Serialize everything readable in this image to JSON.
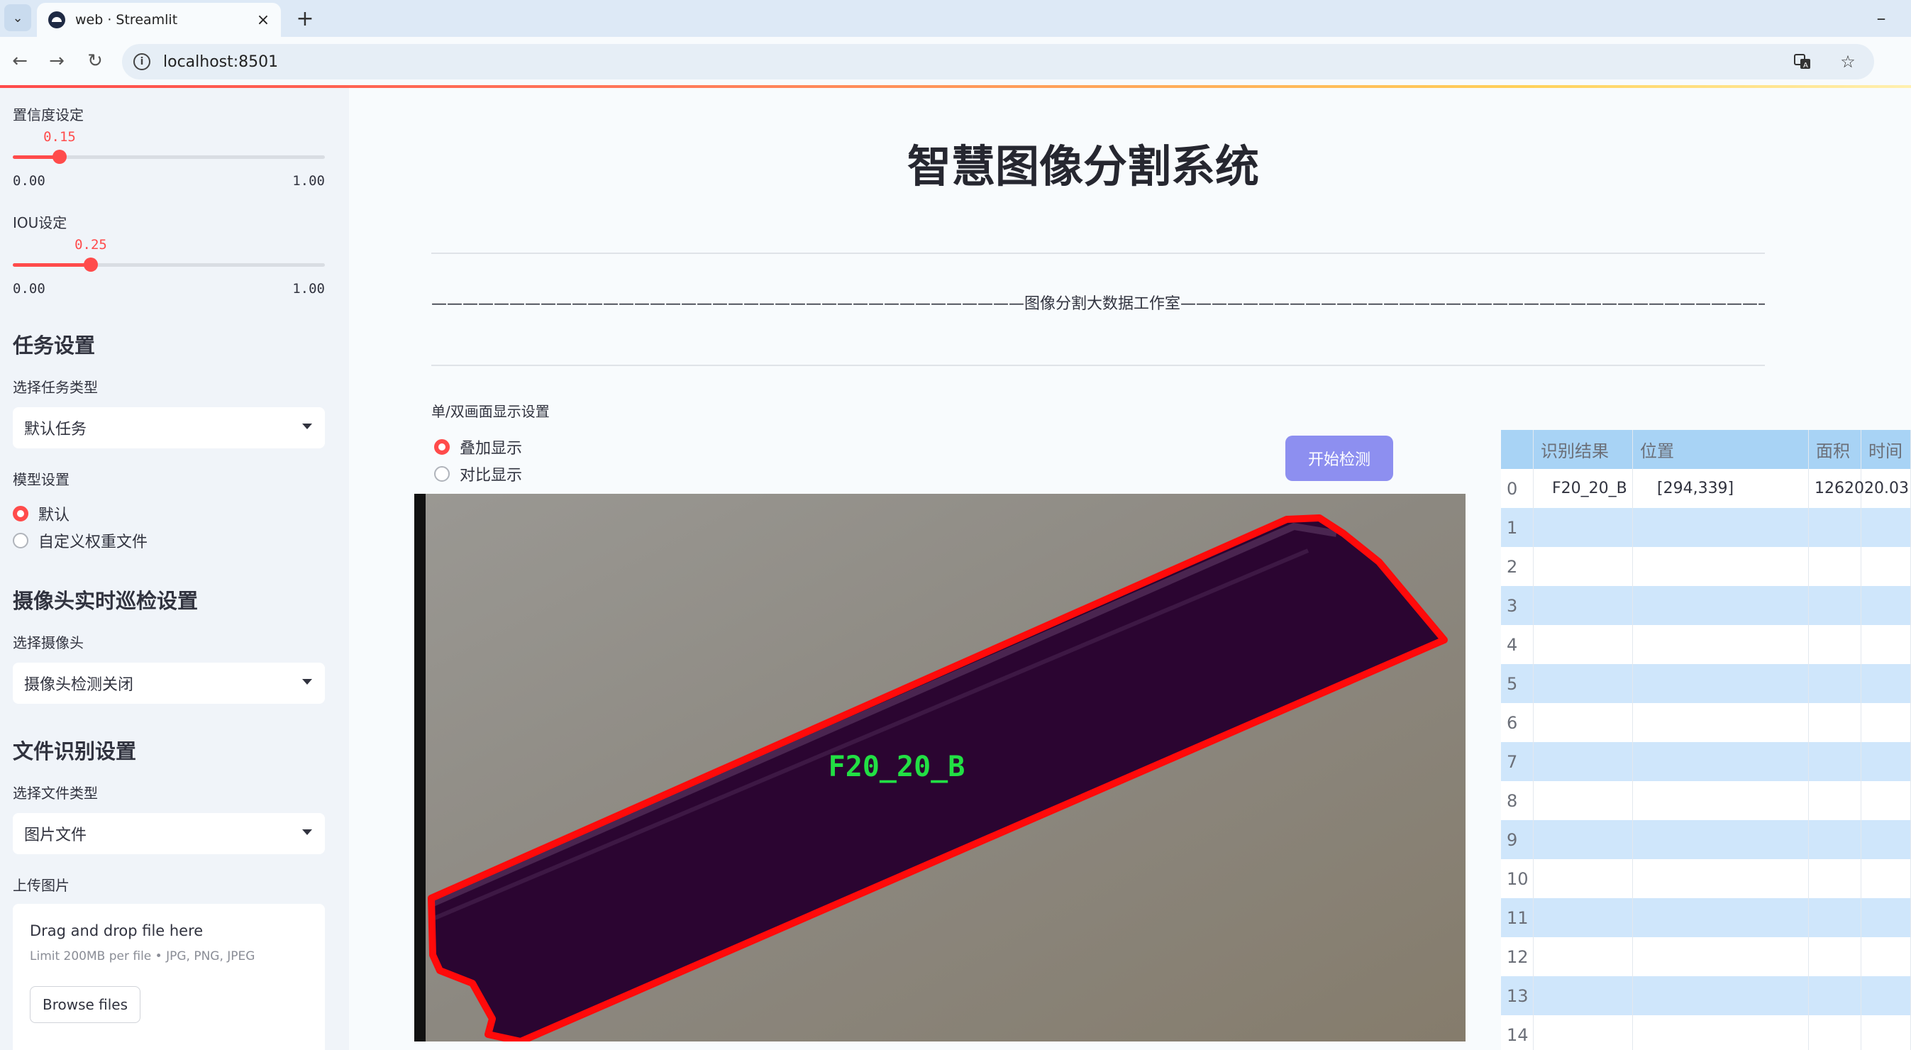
{
  "browser": {
    "tab_title": "web · Streamlit",
    "url": "localhost:8501"
  },
  "sidebar": {
    "confidence": {
      "label": "置信度设定",
      "value": "0.15",
      "value_num": 0.15,
      "min": "0.00",
      "max": "1.00"
    },
    "iou": {
      "label": "IOU设定",
      "value": "0.25",
      "value_num": 0.25,
      "min": "0.00",
      "max": "1.00"
    },
    "task_header": "任务设置",
    "task_type_label": "选择任务类型",
    "task_type_value": "默认任务",
    "model_label": "模型设置",
    "model_options": [
      "默认",
      "自定义权重文件"
    ],
    "camera_header": "摄像头实时巡检设置",
    "camera_label": "选择摄像头",
    "camera_value": "摄像头检测关闭",
    "file_header": "文件识别设置",
    "file_type_label": "选择文件类型",
    "file_type_value": "图片文件",
    "upload_label": "上传图片",
    "upload_title": "Drag and drop file here",
    "upload_limit": "Limit 200MB per file • JPG, PNG, JPEG",
    "browse_label": "Browse files"
  },
  "main": {
    "title": "智慧图像分割系统",
    "divider_text": "——————————————————————————————————————图像分割大数据工作室——————————————————————————————————————",
    "display_label": "单/双画面显示设置",
    "display_options": [
      "叠加显示",
      "对比显示"
    ],
    "start_button": "开始检测",
    "detection_label": "F20_20_B",
    "colors": {
      "mask": "#2b0531",
      "outline": "#ff0a0a",
      "label": "#22e044",
      "accent": "#ff4b4b",
      "button": "#8d8ff0"
    }
  },
  "table": {
    "columns": [
      "",
      "识别结果",
      "位置",
      "面积",
      "时间"
    ],
    "rows": [
      [
        "0",
        "F20_20_B",
        "[294,339]",
        "1262020.03",
        ""
      ],
      [
        "1",
        "",
        "",
        "",
        ""
      ],
      [
        "2",
        "",
        "",
        "",
        ""
      ],
      [
        "3",
        "",
        "",
        "",
        ""
      ],
      [
        "4",
        "",
        "",
        "",
        ""
      ],
      [
        "5",
        "",
        "",
        "",
        ""
      ],
      [
        "6",
        "",
        "",
        "",
        ""
      ],
      [
        "7",
        "",
        "",
        "",
        ""
      ],
      [
        "8",
        "",
        "",
        "",
        ""
      ],
      [
        "9",
        "",
        "",
        "",
        ""
      ],
      [
        "10",
        "",
        "",
        "",
        ""
      ],
      [
        "11",
        "",
        "",
        "",
        ""
      ],
      [
        "12",
        "",
        "",
        "",
        ""
      ],
      [
        "13",
        "",
        "",
        "",
        ""
      ],
      [
        "14",
        "",
        "",
        "",
        ""
      ]
    ]
  }
}
